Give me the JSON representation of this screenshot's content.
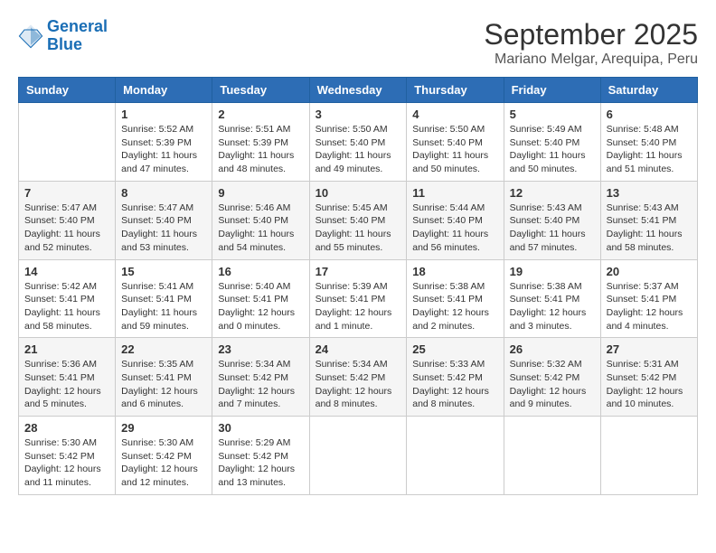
{
  "header": {
    "logo_line1": "General",
    "logo_line2": "Blue",
    "month": "September 2025",
    "location": "Mariano Melgar, Arequipa, Peru"
  },
  "weekdays": [
    "Sunday",
    "Monday",
    "Tuesday",
    "Wednesday",
    "Thursday",
    "Friday",
    "Saturday"
  ],
  "weeks": [
    [
      {
        "day": "",
        "info": ""
      },
      {
        "day": "1",
        "info": "Sunrise: 5:52 AM\nSunset: 5:39 PM\nDaylight: 11 hours\nand 47 minutes."
      },
      {
        "day": "2",
        "info": "Sunrise: 5:51 AM\nSunset: 5:39 PM\nDaylight: 11 hours\nand 48 minutes."
      },
      {
        "day": "3",
        "info": "Sunrise: 5:50 AM\nSunset: 5:40 PM\nDaylight: 11 hours\nand 49 minutes."
      },
      {
        "day": "4",
        "info": "Sunrise: 5:50 AM\nSunset: 5:40 PM\nDaylight: 11 hours\nand 50 minutes."
      },
      {
        "day": "5",
        "info": "Sunrise: 5:49 AM\nSunset: 5:40 PM\nDaylight: 11 hours\nand 50 minutes."
      },
      {
        "day": "6",
        "info": "Sunrise: 5:48 AM\nSunset: 5:40 PM\nDaylight: 11 hours\nand 51 minutes."
      }
    ],
    [
      {
        "day": "7",
        "info": "Sunrise: 5:47 AM\nSunset: 5:40 PM\nDaylight: 11 hours\nand 52 minutes."
      },
      {
        "day": "8",
        "info": "Sunrise: 5:47 AM\nSunset: 5:40 PM\nDaylight: 11 hours\nand 53 minutes."
      },
      {
        "day": "9",
        "info": "Sunrise: 5:46 AM\nSunset: 5:40 PM\nDaylight: 11 hours\nand 54 minutes."
      },
      {
        "day": "10",
        "info": "Sunrise: 5:45 AM\nSunset: 5:40 PM\nDaylight: 11 hours\nand 55 minutes."
      },
      {
        "day": "11",
        "info": "Sunrise: 5:44 AM\nSunset: 5:40 PM\nDaylight: 11 hours\nand 56 minutes."
      },
      {
        "day": "12",
        "info": "Sunrise: 5:43 AM\nSunset: 5:40 PM\nDaylight: 11 hours\nand 57 minutes."
      },
      {
        "day": "13",
        "info": "Sunrise: 5:43 AM\nSunset: 5:41 PM\nDaylight: 11 hours\nand 58 minutes."
      }
    ],
    [
      {
        "day": "14",
        "info": "Sunrise: 5:42 AM\nSunset: 5:41 PM\nDaylight: 11 hours\nand 58 minutes."
      },
      {
        "day": "15",
        "info": "Sunrise: 5:41 AM\nSunset: 5:41 PM\nDaylight: 11 hours\nand 59 minutes."
      },
      {
        "day": "16",
        "info": "Sunrise: 5:40 AM\nSunset: 5:41 PM\nDaylight: 12 hours\nand 0 minutes."
      },
      {
        "day": "17",
        "info": "Sunrise: 5:39 AM\nSunset: 5:41 PM\nDaylight: 12 hours\nand 1 minute."
      },
      {
        "day": "18",
        "info": "Sunrise: 5:38 AM\nSunset: 5:41 PM\nDaylight: 12 hours\nand 2 minutes."
      },
      {
        "day": "19",
        "info": "Sunrise: 5:38 AM\nSunset: 5:41 PM\nDaylight: 12 hours\nand 3 minutes."
      },
      {
        "day": "20",
        "info": "Sunrise: 5:37 AM\nSunset: 5:41 PM\nDaylight: 12 hours\nand 4 minutes."
      }
    ],
    [
      {
        "day": "21",
        "info": "Sunrise: 5:36 AM\nSunset: 5:41 PM\nDaylight: 12 hours\nand 5 minutes."
      },
      {
        "day": "22",
        "info": "Sunrise: 5:35 AM\nSunset: 5:41 PM\nDaylight: 12 hours\nand 6 minutes."
      },
      {
        "day": "23",
        "info": "Sunrise: 5:34 AM\nSunset: 5:42 PM\nDaylight: 12 hours\nand 7 minutes."
      },
      {
        "day": "24",
        "info": "Sunrise: 5:34 AM\nSunset: 5:42 PM\nDaylight: 12 hours\nand 8 minutes."
      },
      {
        "day": "25",
        "info": "Sunrise: 5:33 AM\nSunset: 5:42 PM\nDaylight: 12 hours\nand 8 minutes."
      },
      {
        "day": "26",
        "info": "Sunrise: 5:32 AM\nSunset: 5:42 PM\nDaylight: 12 hours\nand 9 minutes."
      },
      {
        "day": "27",
        "info": "Sunrise: 5:31 AM\nSunset: 5:42 PM\nDaylight: 12 hours\nand 10 minutes."
      }
    ],
    [
      {
        "day": "28",
        "info": "Sunrise: 5:30 AM\nSunset: 5:42 PM\nDaylight: 12 hours\nand 11 minutes."
      },
      {
        "day": "29",
        "info": "Sunrise: 5:30 AM\nSunset: 5:42 PM\nDaylight: 12 hours\nand 12 minutes."
      },
      {
        "day": "30",
        "info": "Sunrise: 5:29 AM\nSunset: 5:42 PM\nDaylight: 12 hours\nand 13 minutes."
      },
      {
        "day": "",
        "info": ""
      },
      {
        "day": "",
        "info": ""
      },
      {
        "day": "",
        "info": ""
      },
      {
        "day": "",
        "info": ""
      }
    ]
  ]
}
